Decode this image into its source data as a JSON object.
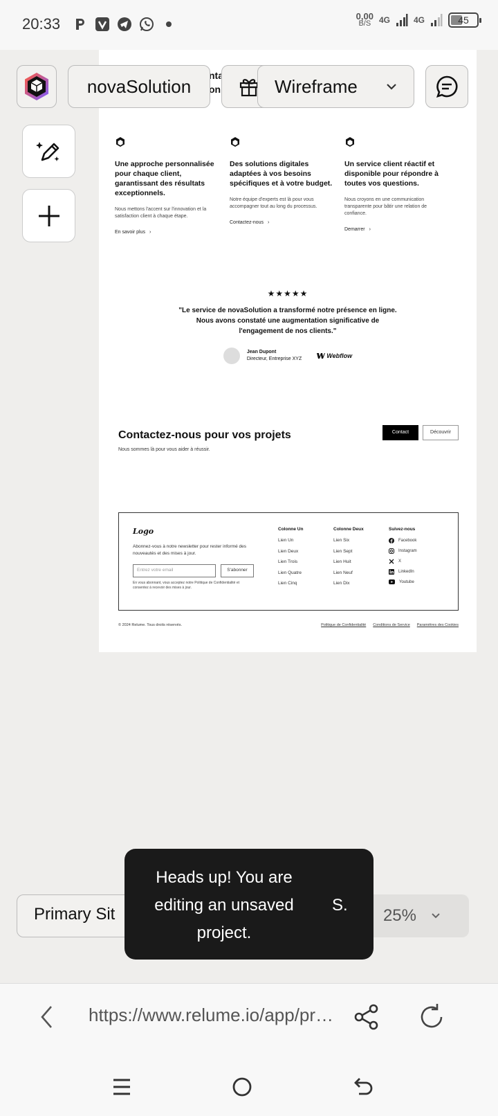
{
  "status_bar": {
    "time": "20:33",
    "speed_value": "0,00",
    "speed_unit": "B/S",
    "net1": "4G",
    "net2": "4G",
    "battery": "45"
  },
  "toolbar": {
    "project_name": "novaSolution",
    "mode": "Wireframe",
    "overflow_text": "nta\non"
  },
  "features": [
    {
      "title": "Une approche personnalisée pour chaque client, garantissant des résultats exceptionnels.",
      "body": "Nous mettons l'accent sur l'innovation et la satisfaction client à chaque étape.",
      "link": "En savoir plus"
    },
    {
      "title": "Des solutions digitales adaptées à vos besoins spécifiques et à votre budget.",
      "body": "Notre équipe d'experts est là pour vous accompagner tout au long du processus.",
      "link": "Contactez-nous"
    },
    {
      "title": "Un service client réactif et disponible pour répondre à toutes vos questions.",
      "body": "Nous croyons en une communication transparente pour bâtir une relation de confiance.",
      "link": "Demarrer"
    }
  ],
  "testimonial": {
    "stars": "★★★★★",
    "rating": 5,
    "quote": "\"Le service de novaSolution a transformé notre présence en ligne. Nous avons constaté une augmentation significative de l'engagement de nos clients.\"",
    "author_name": "Jean Dupont",
    "author_title": "Directeur, Entreprise XYZ",
    "company_logo": "Webflow"
  },
  "cta": {
    "heading": "Contactez-nous pour vos projets",
    "subheading": "Nous sommes là pour vous aider à réussir.",
    "primary_button": "Contact",
    "secondary_button": "Découvrir"
  },
  "footer": {
    "logo": "Logo",
    "newsletter_text": "Abonnez-vous à notre newsletter pour rester informé des nouveautés et des mises à jour.",
    "email_placeholder": "Entrez votre email",
    "subscribe_button": "S'abonner",
    "legal_text": "En vous abonnant, vous acceptez notre Politique de Confidentialité et consentez à recevoir des mises à jour.",
    "columns": [
      {
        "title": "Colonne Un",
        "links": [
          "Lien Un",
          "Lien Deux",
          "Lien Trois",
          "Lien Quatre",
          "Lien Cinq"
        ]
      },
      {
        "title": "Colonne Deux",
        "links": [
          "Lien Six",
          "Lien Sept",
          "Lien Huit",
          "Lien Neuf",
          "Lien Dix"
        ]
      }
    ],
    "social_title": "Suivez-nous",
    "social": [
      "Facebook",
      "Instagram",
      "X",
      "LinkedIn",
      "Youtube"
    ],
    "copyright": "© 2024 Relume. Tous droits réservés.",
    "bottom_links": [
      "Politique de Confidentialité",
      "Conditions de Service",
      "Paramètres des Cookies"
    ]
  },
  "bottom_bar": {
    "page_name": "Primary Sit",
    "zoom": "25%"
  },
  "toast": {
    "message": "Heads up! You are editing an unsaved project.",
    "trailing": "S."
  },
  "browser": {
    "url": "https://www.relume.io/app/project/..."
  }
}
